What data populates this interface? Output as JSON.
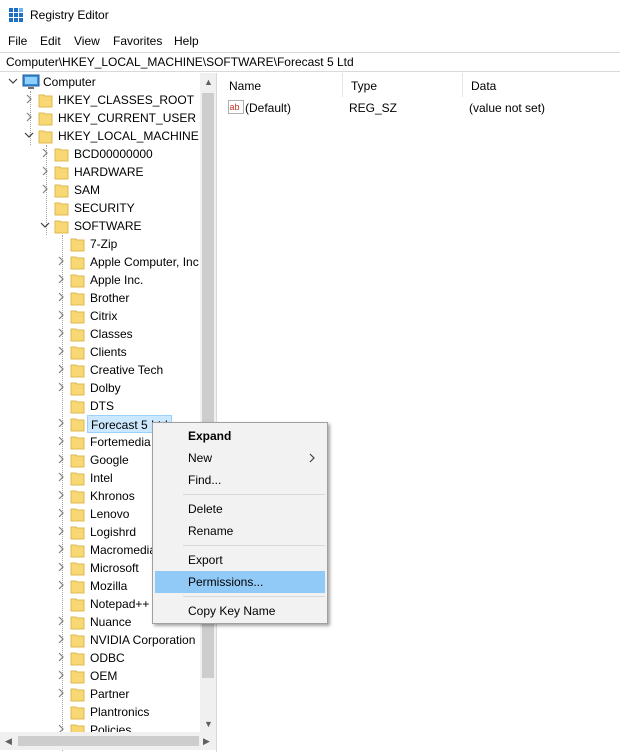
{
  "window": {
    "title": "Registry Editor"
  },
  "menu": [
    "File",
    "Edit",
    "View",
    "Favorites",
    "Help"
  ],
  "address": "Computer\\HKEY_LOCAL_MACHINE\\SOFTWARE\\Forecast 5 Ltd",
  "tree": {
    "root": "Computer",
    "hives": [
      "HKEY_CLASSES_ROOT",
      "HKEY_CURRENT_USER",
      "HKEY_LOCAL_MACHINE"
    ],
    "hklm_children": [
      "BCD00000000",
      "HARDWARE",
      "SAM",
      "SECURITY",
      "SOFTWARE"
    ],
    "software_children": [
      "7-Zip",
      "Apple Computer, Inc",
      "Apple Inc.",
      "Brother",
      "Citrix",
      "Classes",
      "Clients",
      "Creative Tech",
      "Dolby",
      "DTS",
      "Forecast 5 Ltd",
      "Fortemedia",
      "Google",
      "Intel",
      "Khronos",
      "Lenovo",
      "Logishrd",
      "Macromedia",
      "Microsoft",
      "Mozilla",
      "Notepad++",
      "Nuance",
      "NVIDIA Corporation",
      "ODBC",
      "OEM",
      "Partner",
      "Plantronics",
      "Policies"
    ],
    "selected": "Forecast 5 Ltd"
  },
  "list": {
    "columns": [
      "Name",
      "Type",
      "Data"
    ],
    "rows": [
      {
        "name": "(Default)",
        "type": "REG_SZ",
        "data": "(value not set)"
      }
    ]
  },
  "context_menu": {
    "items": [
      "Expand",
      "New",
      "Find...",
      "Delete",
      "Rename",
      "Export",
      "Permissions...",
      "Copy Key Name"
    ],
    "highlighted": "Permissions..."
  },
  "colors": {
    "folder": "#f8d775",
    "selection_highlight": "#91c9f7",
    "tree_selection": "#cce8ff",
    "icon_blue": "#1f6fc5"
  }
}
